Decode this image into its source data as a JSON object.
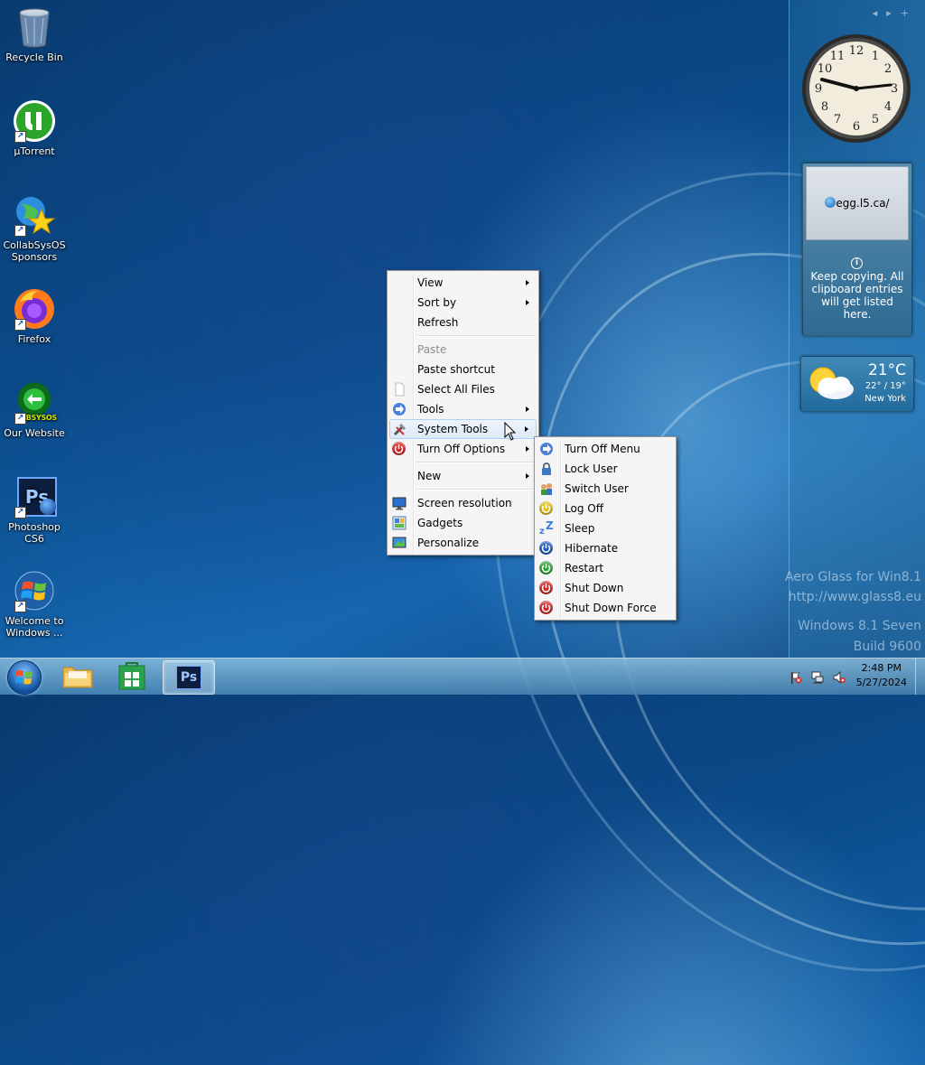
{
  "desktop_icons": [
    {
      "label": "Recycle Bin",
      "icon": "recycle-bin-icon"
    },
    {
      "label": "µTorrent",
      "icon": "utorrent-icon"
    },
    {
      "label": "CollabSysOS Sponsors",
      "icon": "globe-star-icon"
    },
    {
      "label": "Firefox",
      "icon": "firefox-icon"
    },
    {
      "label": "Our Website",
      "icon": "labsysos-icon",
      "icon_text": "LABSYSOS"
    },
    {
      "label": "Photoshop CS6",
      "icon": "photoshop-icon",
      "icon_text": "Ps"
    },
    {
      "label": "Welcome to Windows ...",
      "icon": "windows-logo-icon"
    }
  ],
  "context_menu": {
    "items": [
      {
        "label": "View"
      },
      {
        "label": "Sort by"
      },
      {
        "label": "Refresh"
      },
      {
        "label": "Paste"
      },
      {
        "label": "Paste shortcut"
      },
      {
        "label": "Select All Files"
      },
      {
        "label": "Tools"
      },
      {
        "label": "System Tools"
      },
      {
        "label": "Turn Off Options"
      },
      {
        "label": "New"
      },
      {
        "label": "Screen resolution"
      },
      {
        "label": "Gadgets"
      },
      {
        "label": "Personalize"
      }
    ]
  },
  "submenu": {
    "items": [
      {
        "label": "Turn Off Menu"
      },
      {
        "label": "Lock User"
      },
      {
        "label": "Switch User"
      },
      {
        "label": "Log Off"
      },
      {
        "label": "Sleep"
      },
      {
        "label": "Hibernate"
      },
      {
        "label": "Restart"
      },
      {
        "label": "Shut Down"
      },
      {
        "label": "Shut Down Force"
      }
    ]
  },
  "gadgets": {
    "clock_numbers": [
      "12",
      "1",
      "2",
      "3",
      "4",
      "5",
      "6",
      "7",
      "8",
      "9",
      "10",
      "11"
    ],
    "clipboard": {
      "url": "egg.l5.ca/",
      "message": "Keep copying. All clipboard entries will get listed here."
    },
    "weather": {
      "temp": "21°C",
      "range": "22° / 19°",
      "city": "New York"
    }
  },
  "watermark": {
    "line1": "Aero Glass for Win8.1",
    "line2": "http://www.glass8.eu",
    "line3": "Windows 8.1 Seven",
    "line4": "Build 9600"
  },
  "taskbar": {
    "time": "2:48 PM",
    "date": "5/27/2024",
    "ps_label": "Ps"
  }
}
